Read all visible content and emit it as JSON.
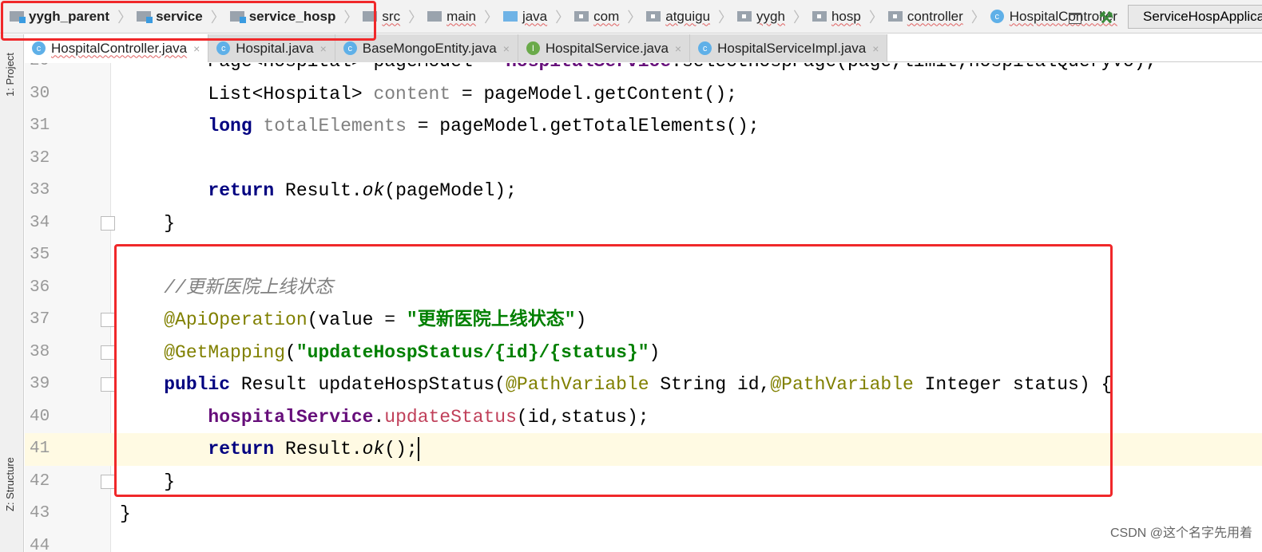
{
  "breadcrumb": [
    {
      "label": "yygh_parent",
      "icon": "module-folder-icon",
      "bold": true
    },
    {
      "label": "service",
      "icon": "module-folder-icon",
      "bold": true
    },
    {
      "label": "service_hosp",
      "icon": "module-folder-icon",
      "bold": true
    },
    {
      "label": "src",
      "icon": "folder-icon"
    },
    {
      "label": "main",
      "icon": "folder-icon"
    },
    {
      "label": "java",
      "icon": "source-folder-icon"
    },
    {
      "label": "com",
      "icon": "package-icon"
    },
    {
      "label": "atguigu",
      "icon": "package-icon"
    },
    {
      "label": "yygh",
      "icon": "package-icon"
    },
    {
      "label": "hosp",
      "icon": "package-icon"
    },
    {
      "label": "controller",
      "icon": "package-icon"
    },
    {
      "label": "HospitalController",
      "icon": "class-icon"
    }
  ],
  "run_config": "ServiceHospApplication",
  "tabs": [
    {
      "label": "HospitalController.java",
      "type": "C",
      "active": true
    },
    {
      "label": "Hospital.java",
      "type": "C"
    },
    {
      "label": "BaseMongoEntity.java",
      "type": "C"
    },
    {
      "label": "HospitalService.java",
      "type": "I"
    },
    {
      "label": "HospitalServiceImpl.java",
      "type": "C"
    }
  ],
  "side_tools": {
    "project": "1: Project",
    "structure": "Z: Structure"
  },
  "current_line": 41,
  "code": [
    {
      "n": "29",
      "fold": false,
      "t": [
        [
          "        Page<Hospital> pageModel = ",
          "pl"
        ],
        [
          "hospitalService",
          "fld"
        ],
        [
          ".selectHospPage(page,limit,hospitalQueryVo);",
          "pl"
        ]
      ]
    },
    {
      "n": "30",
      "t": [
        [
          "        List<Hospital> ",
          "pl"
        ],
        [
          "content",
          "un"
        ],
        [
          " = pageModel.getContent();",
          "pl"
        ]
      ]
    },
    {
      "n": "31",
      "t": [
        [
          "        ",
          "pl"
        ],
        [
          "long",
          "kw"
        ],
        [
          " ",
          "pl"
        ],
        [
          "totalElements",
          "un"
        ],
        [
          " = pageModel.getTotalElements();",
          "pl"
        ]
      ]
    },
    {
      "n": "32",
      "t": []
    },
    {
      "n": "33",
      "t": [
        [
          "        ",
          "pl"
        ],
        [
          "return",
          "kw"
        ],
        [
          " Result.",
          "pl"
        ],
        [
          "ok",
          "st"
        ],
        [
          "(pageModel);",
          "pl"
        ]
      ]
    },
    {
      "n": "34",
      "fold": true,
      "t": [
        [
          "    }",
          "pl"
        ]
      ]
    },
    {
      "n": "35",
      "t": []
    },
    {
      "n": "36",
      "t": [
        [
          "    //更新医院上线状态",
          "cm"
        ]
      ]
    },
    {
      "n": "37",
      "fold": true,
      "t": [
        [
          "    ",
          "pl"
        ],
        [
          "@ApiOperation",
          "an"
        ],
        [
          "(value = ",
          "pl"
        ],
        [
          "\"更新医院上线状态\"",
          "str"
        ],
        [
          ")",
          "pl"
        ]
      ]
    },
    {
      "n": "38",
      "fold": true,
      "t": [
        [
          "    ",
          "pl"
        ],
        [
          "@GetMapping",
          "an"
        ],
        [
          "(",
          "pl"
        ],
        [
          "\"updateHospStatus/{id}/{status}\"",
          "str"
        ],
        [
          ")",
          "pl"
        ]
      ]
    },
    {
      "n": "39",
      "fold": true,
      "t": [
        [
          "    ",
          "pl"
        ],
        [
          "public",
          "kw"
        ],
        [
          " Result updateHospStatus(",
          "pl"
        ],
        [
          "@PathVariable",
          "an"
        ],
        [
          " String id,",
          "pl"
        ],
        [
          "@PathVariable",
          "an"
        ],
        [
          " Integer status) {",
          "pl"
        ]
      ]
    },
    {
      "n": "40",
      "t": [
        [
          "        ",
          "pl"
        ],
        [
          "hospitalService",
          "fld"
        ],
        [
          ".",
          "pl"
        ],
        [
          "updateStatus",
          "err"
        ],
        [
          "(id,status);",
          "pl"
        ]
      ]
    },
    {
      "n": "41",
      "t": [
        [
          "        ",
          "pl"
        ],
        [
          "return",
          "kw"
        ],
        [
          " Result.",
          "pl"
        ],
        [
          "ok",
          "st"
        ],
        [
          "();",
          "pl"
        ]
      ]
    },
    {
      "n": "42",
      "fold": true,
      "t": [
        [
          "    }",
          "pl"
        ]
      ]
    },
    {
      "n": "43",
      "t": [
        [
          "}",
          "pl"
        ]
      ]
    },
    {
      "n": "44",
      "t": []
    }
  ],
  "watermark": "CSDN @这个名字先用着",
  "colors": {
    "highlight_box": "#f0282a",
    "current_line": "#fffae3",
    "keyword": "#000080",
    "annotation": "#808000",
    "string": "#008000"
  }
}
